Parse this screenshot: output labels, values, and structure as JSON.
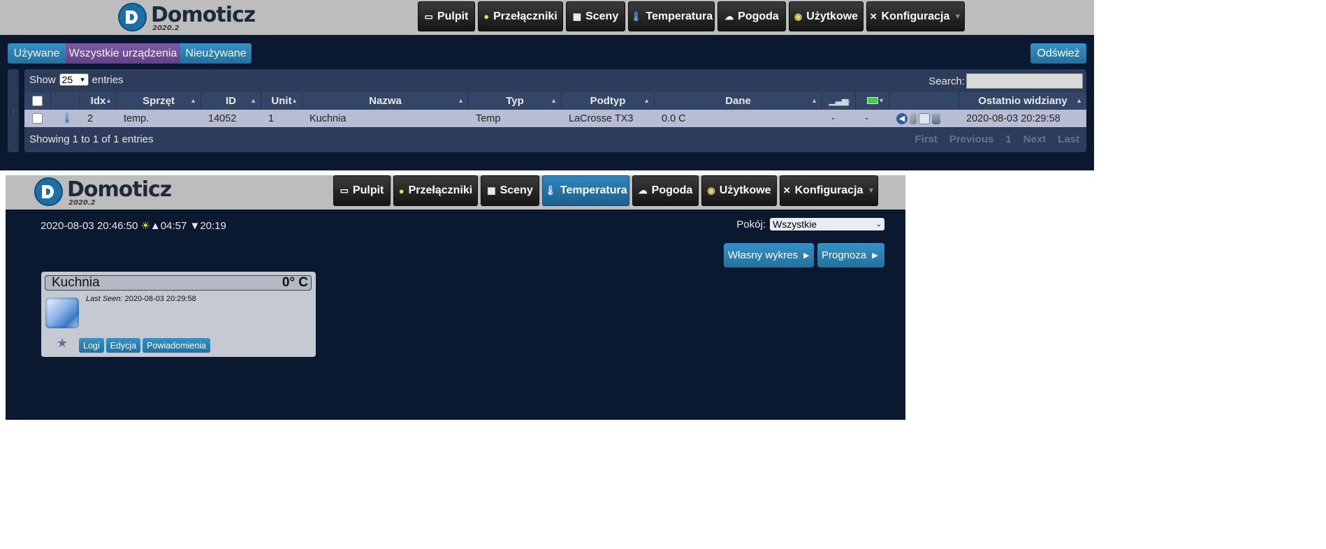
{
  "app": {
    "name": "Domoticz",
    "version": "2020.2"
  },
  "nav": {
    "pulpit": "Pulpit",
    "przelaczniki": "Przełączniki",
    "sceny": "Sceny",
    "temperatura": "Temperatura",
    "pogoda": "Pogoda",
    "uzytkowe": "Użytkowe",
    "konfiguracja": "Konfiguracja"
  },
  "devices_page": {
    "tabs": {
      "used": "Używane",
      "all": "Wszystkie urządzenia",
      "unused": "Nieużywane"
    },
    "refresh": "Odśwież",
    "show_label": "Show",
    "show_value": "25",
    "entries_label": "entries",
    "search_label": "Search:",
    "columns": {
      "idx": "Idx",
      "sprzet": "Sprzęt",
      "id": "ID",
      "unit": "Unit",
      "nazwa": "Nazwa",
      "typ": "Typ",
      "podtyp": "Podtyp",
      "dane": "Dane",
      "ostatnio": "Ostatnio widziany"
    },
    "row": {
      "idx": "2",
      "sprzet": "temp.",
      "id": "14052",
      "unit": "1",
      "nazwa": "Kuchnia",
      "typ": "Temp",
      "podtyp": "LaCrosse TX3",
      "dane": "0.0 C",
      "signal": "-",
      "battery": "-",
      "ostatnio": "2020-08-03 20:29:58"
    },
    "footer": "Showing 1 to 1 of 1 entries",
    "pager": {
      "first": "First",
      "previous": "Previous",
      "page": "1",
      "next": "Next",
      "last": "Last"
    }
  },
  "temperature_page": {
    "datetime": "2020-08-03 20:46:50",
    "sunrise": "▲04:57",
    "sunset": "▼20:19",
    "room_label": "Pokój:",
    "room_value": "Wszystkie",
    "custom_chart": "Własny wykres",
    "forecast": "Prognoza",
    "card": {
      "name": "Kuchnia",
      "value": "0° C",
      "last_seen_label": "Last Seen:",
      "last_seen_value": "2020-08-03 20:29:58",
      "btn_log": "Logi",
      "btn_edit": "Edycja",
      "btn_notify": "Powiadomienia"
    }
  },
  "colors": {
    "navbar_bg": "#bdbdbd",
    "page_bg": "#0a1930",
    "accent_blue": "#2b7fb4",
    "accent_purple": "#6f4c96"
  }
}
